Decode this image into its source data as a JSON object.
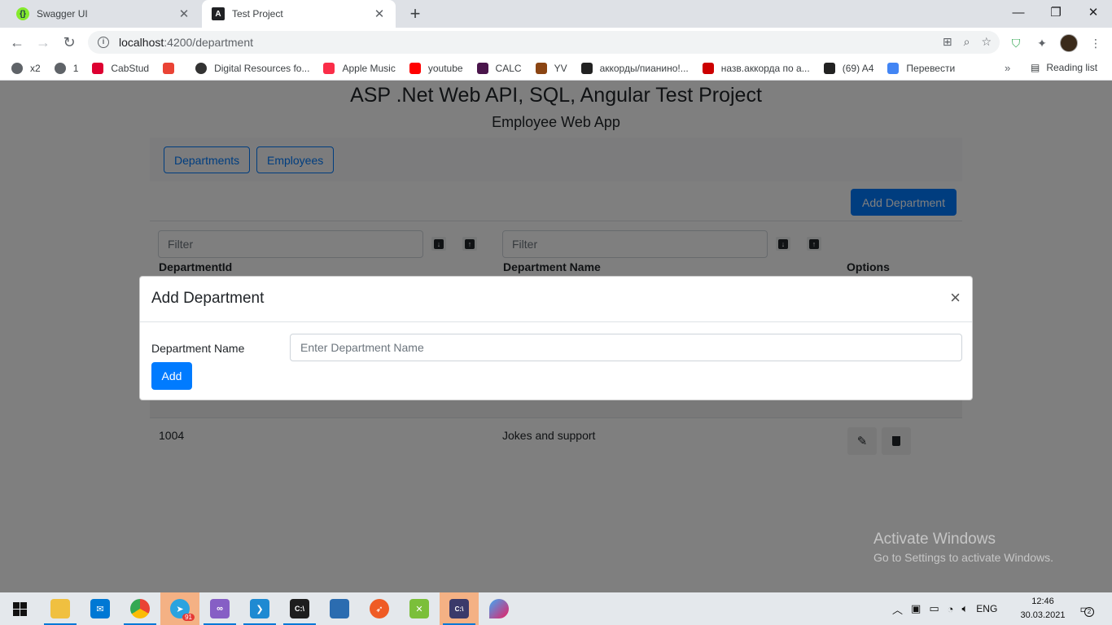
{
  "browser": {
    "tabs": [
      {
        "title": "Swagger UI",
        "favicon": "swagger-icon",
        "color": "#85ea2d"
      },
      {
        "title": "Test Project",
        "favicon": "angular-icon",
        "color": "#202124"
      }
    ],
    "url_host": "localhost",
    "url_path": ":4200/department",
    "bookmarks": [
      {
        "label": "x2",
        "icon": "globe-icon",
        "color": "#5f6368"
      },
      {
        "label": "1",
        "icon": "globe-icon",
        "color": "#5f6368"
      },
      {
        "label": "CabStud",
        "icon": "angular-icon",
        "color": "#dd0031"
      },
      {
        "label": "",
        "icon": "gmail-icon",
        "color": "#ea4335"
      },
      {
        "label": "Digital Resources fo...",
        "icon": "globe-icon",
        "color": "#333333"
      },
      {
        "label": "Apple Music",
        "icon": "music-icon",
        "color": "#fa2d48"
      },
      {
        "label": "youtube",
        "icon": "youtube-icon",
        "color": "#ff0000"
      },
      {
        "label": "CALC",
        "icon": "slack-icon",
        "color": "#4a154b"
      },
      {
        "label": "YV",
        "icon": "bible-icon",
        "color": "#8b4513"
      },
      {
        "label": "аккорды/пианино!...",
        "icon": "piano-icon",
        "color": "#222222"
      },
      {
        "label": "назв.аккорда по а...",
        "icon": "chord-icon",
        "color": "#cc0000"
      },
      {
        "label": "(69) A4",
        "icon": "barcode-icon",
        "color": "#222222"
      },
      {
        "label": "Перевести",
        "icon": "translate-icon",
        "color": "#4285f4"
      }
    ],
    "reading_list": "Reading list"
  },
  "app": {
    "title": "ASP .Net Web API, SQL, Angular Test Project",
    "subtitle": "Employee Web App",
    "nav": {
      "departments": "Departments",
      "employees": "Employees"
    },
    "add_department_button": "Add Department",
    "table": {
      "filter_placeholder": "Filter",
      "headers": [
        "DepartmentId",
        "Department Name",
        "Options"
      ],
      "rows": [
        {
          "id": "1004",
          "name": "Jokes and support"
        }
      ]
    }
  },
  "modal": {
    "title": "Add Department",
    "label": "Department Name",
    "input_placeholder": "Enter Department Name",
    "input_value": "",
    "add_button": "Add",
    "close": "×"
  },
  "watermark": {
    "line1": "Activate Windows",
    "line2": "Go to Settings to activate Windows."
  },
  "taskbar": {
    "apps": [
      "start-icon",
      "file-explorer-icon",
      "mail-icon",
      "chrome-icon",
      "telegram-icon",
      "visual-studio-icon",
      "vscode-icon",
      "terminal-icon",
      "app-icon",
      "postman-icon",
      "tool-icon",
      "console-app-icon",
      "paint-icon"
    ],
    "telegram_badge": "91",
    "language": "ENG",
    "time": "12:46",
    "date": "30.03.2021",
    "notifications": "2"
  }
}
